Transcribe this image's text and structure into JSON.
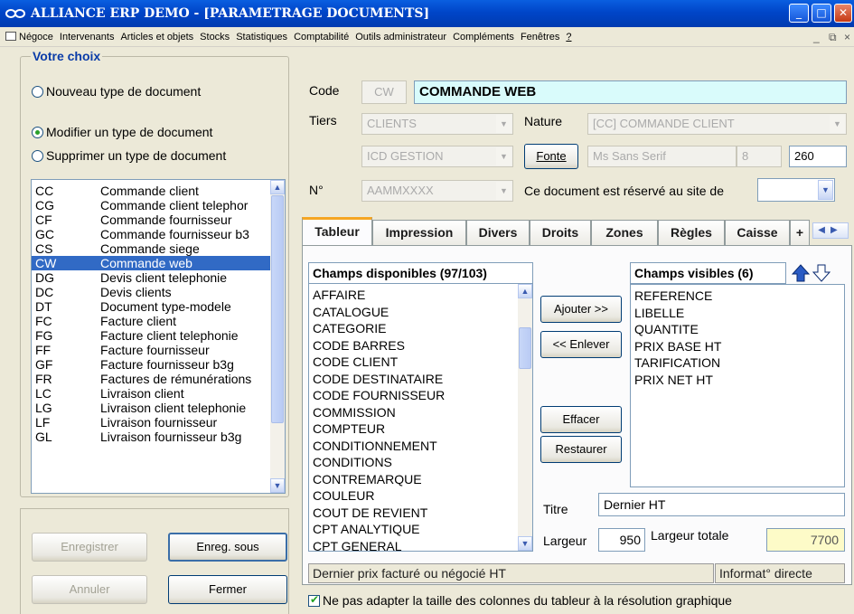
{
  "window": {
    "title": "ALLIANCE ERP DEMO - [PARAMETRAGE DOCUMENTS]",
    "minimize": "_",
    "maximize": "□",
    "close": "✕"
  },
  "menu": {
    "items": [
      "Négoce",
      "Intervenants",
      "Articles et objets",
      "Stocks",
      "Statistiques",
      "Comptabilité",
      "Outils administrateur",
      "Compléments",
      "Fenêtres",
      "?"
    ],
    "mdi_min": "_",
    "mdi_restore": "⧉",
    "mdi_close": "×"
  },
  "choice": {
    "title": "Votre choix",
    "options": [
      {
        "label": "Nouveau type de document",
        "checked": false
      },
      {
        "label": "Modifier un type de document",
        "checked": true
      },
      {
        "label": "Supprimer un type de document",
        "checked": false
      }
    ]
  },
  "doc_types": [
    {
      "code": "CC",
      "name": "Commande client"
    },
    {
      "code": "CG",
      "name": "Commande client telephor"
    },
    {
      "code": "CF",
      "name": "Commande fournisseur"
    },
    {
      "code": "GC",
      "name": "Commande fournisseur b3"
    },
    {
      "code": "CS",
      "name": "Commande siege"
    },
    {
      "code": "CW",
      "name": "Commande web",
      "selected": true
    },
    {
      "code": "DG",
      "name": "Devis client telephonie"
    },
    {
      "code": "DC",
      "name": "Devis clients"
    },
    {
      "code": "DT",
      "name": "Document type-modele"
    },
    {
      "code": "FC",
      "name": "Facture client"
    },
    {
      "code": "FG",
      "name": "Facture client telephonie"
    },
    {
      "code": "FF",
      "name": "Facture fournisseur"
    },
    {
      "code": "GF",
      "name": "Facture fournisseur b3g"
    },
    {
      "code": "FR",
      "name": "Factures de rémunérations"
    },
    {
      "code": "LC",
      "name": "Livraison client"
    },
    {
      "code": "LG",
      "name": "Livraison client telephonie"
    },
    {
      "code": "LF",
      "name": "Livraison fournisseur"
    },
    {
      "code": "GL",
      "name": "Livraison fournisseur b3g"
    }
  ],
  "buttons": {
    "save": "Enregistrer",
    "save_as": "Enreg. sous",
    "cancel": "Annuler",
    "close": "Fermer"
  },
  "form": {
    "code_label": "Code",
    "code_value": "CW",
    "code_desc": "COMMANDE WEB",
    "tiers_label": "Tiers",
    "tiers_value": "CLIENTS",
    "nature_label": "Nature",
    "nature_value": "[CC] COMMANDE CLIENT",
    "gestion_value": "ICD GESTION",
    "font_button": "Fonte",
    "font_name": "Ms Sans Serif",
    "font_size": "8",
    "font_extra": "260",
    "num_label": "N°",
    "num_value": "AAMMXXXX",
    "site_label": "Ce document est réservé au site de",
    "site_value": ""
  },
  "tabs": [
    {
      "label": "Tableur",
      "active": true
    },
    {
      "label": "Impression"
    },
    {
      "label": "Divers"
    },
    {
      "label": "Droits"
    },
    {
      "label": "Zones"
    },
    {
      "label": "Règles"
    },
    {
      "label": "Caisse"
    },
    {
      "label": "+"
    }
  ],
  "tableur": {
    "available_header": "Champs disponibles (97/103)",
    "available": [
      "AFFAIRE",
      "CATALOGUE",
      "CATEGORIE",
      "CODE BARRES",
      "CODE CLIENT",
      "CODE DESTINATAIRE",
      "CODE FOURNISSEUR",
      "COMMISSION",
      "COMPTEUR",
      "CONDITIONNEMENT",
      "CONDITIONS",
      "CONTREMARQUE",
      "COULEUR",
      "COUT DE REVIENT",
      "CPT ANALYTIQUE",
      "CPT GENERAL"
    ],
    "visible_header": "Champs visibles (6)",
    "visible": [
      "REFERENCE",
      "LIBELLE",
      "QUANTITE",
      "PRIX BASE HT",
      "TARIFICATION",
      "PRIX NET HT"
    ],
    "add_button": "Ajouter >>",
    "remove_button": "<< Enlever",
    "clear_button": "Effacer",
    "restore_button": "Restaurer",
    "title_label": "Titre",
    "title_value": "Dernier HT",
    "width_label": "Largeur",
    "width_value": "950",
    "total_width_label": "Largeur totale",
    "total_width_value": "7700",
    "status_text": "Dernier prix facturé ou négocié HT",
    "status_info": "Informat° directe",
    "checkbox_label": "Ne pas adapter la taille des colonnes du tableur à la résolution graphique",
    "checkbox_checked": true
  }
}
